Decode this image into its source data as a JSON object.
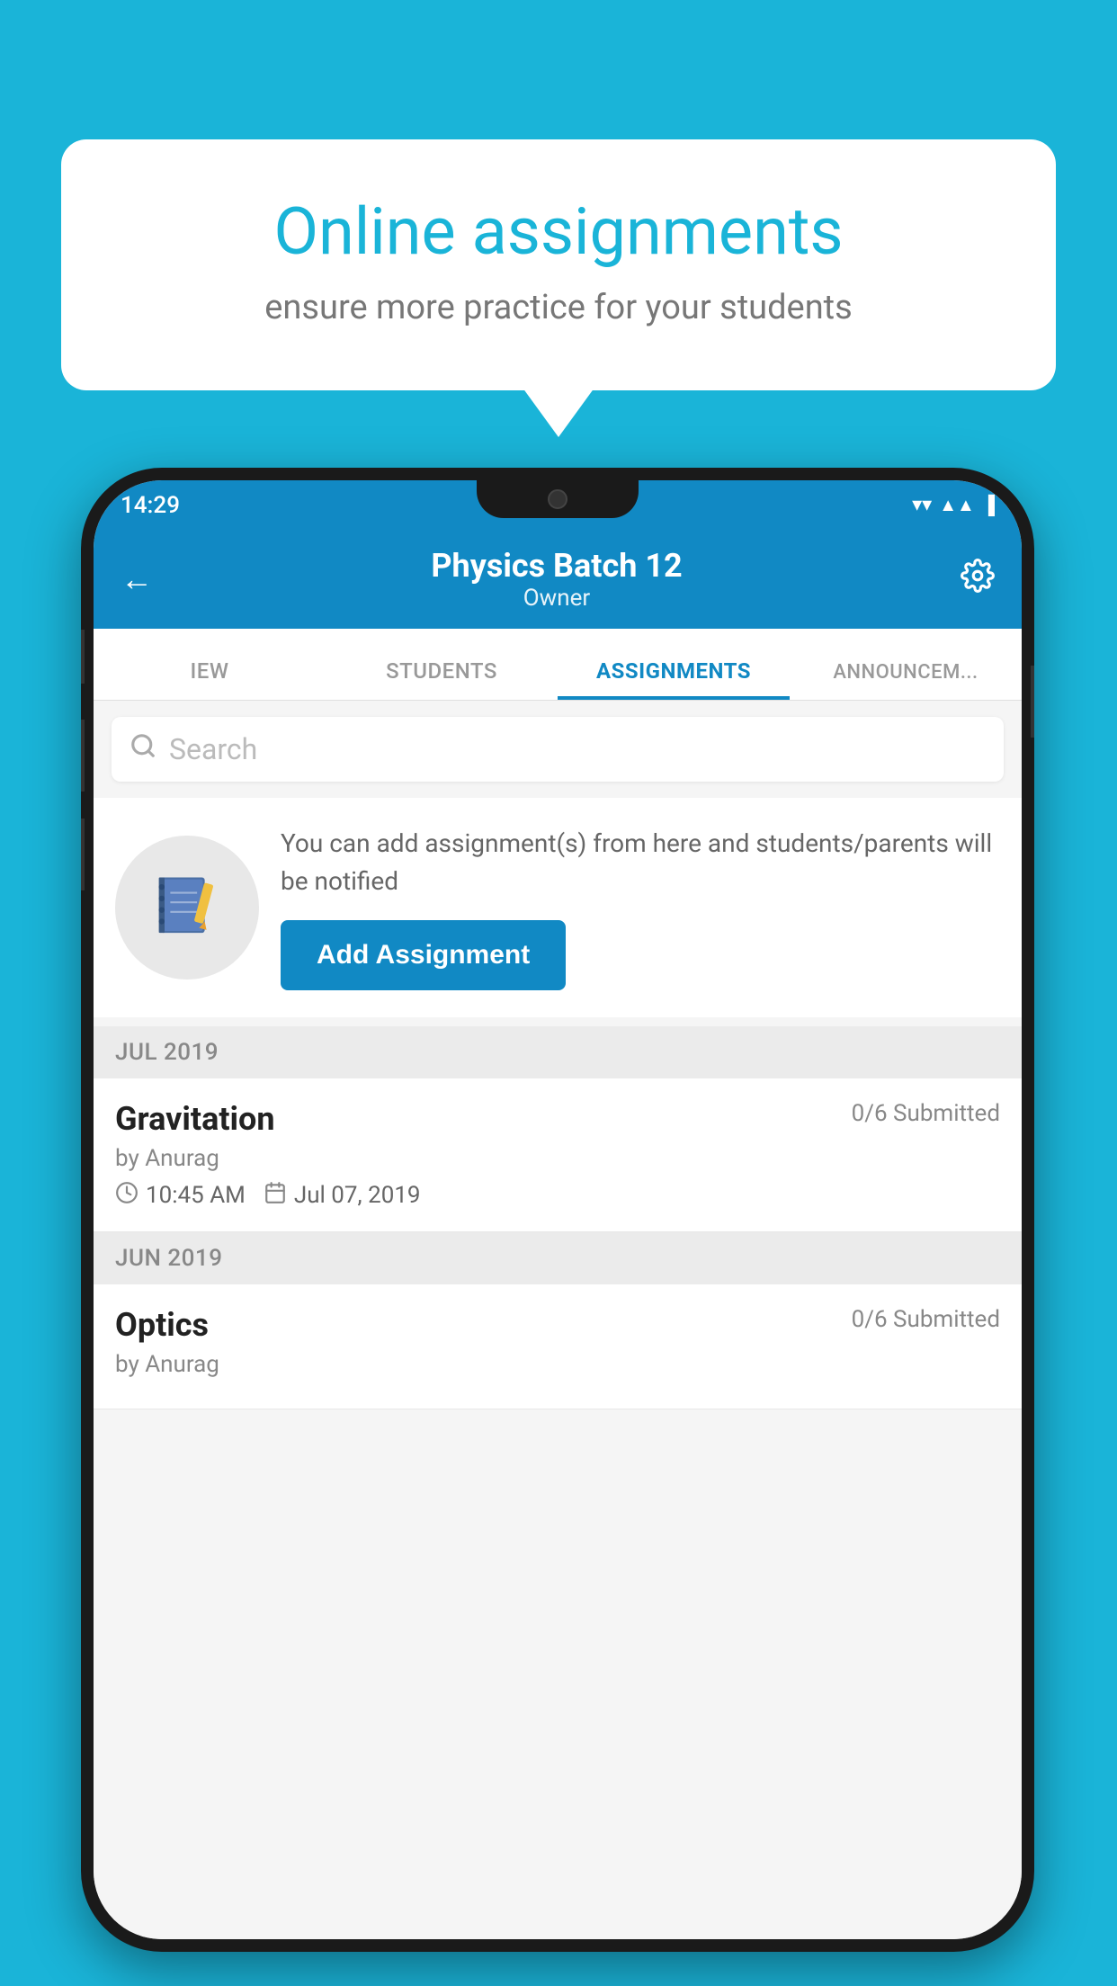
{
  "background_color": "#1ab4d8",
  "speech_bubble": {
    "title": "Online assignments",
    "subtitle": "ensure more practice for your students"
  },
  "phone": {
    "status_bar": {
      "time": "14:29",
      "icons": [
        "wifi",
        "signal",
        "battery"
      ]
    },
    "header": {
      "title": "Physics Batch 12",
      "subtitle": "Owner",
      "back_label": "←",
      "settings_label": "⚙"
    },
    "tabs": [
      {
        "label": "IEW",
        "active": false
      },
      {
        "label": "STUDENTS",
        "active": false
      },
      {
        "label": "ASSIGNMENTS",
        "active": true
      },
      {
        "label": "ANNOUNCEM...",
        "active": false
      }
    ],
    "search": {
      "placeholder": "Search"
    },
    "promo": {
      "description": "You can add assignment(s) from here and students/parents will be notified",
      "button_label": "Add Assignment"
    },
    "assignments": [
      {
        "month_label": "JUL 2019",
        "items": [
          {
            "name": "Gravitation",
            "submitted": "0/6 Submitted",
            "author": "by Anurag",
            "time": "10:45 AM",
            "date": "Jul 07, 2019"
          }
        ]
      },
      {
        "month_label": "JUN 2019",
        "items": [
          {
            "name": "Optics",
            "submitted": "0/6 Submitted",
            "author": "by Anurag",
            "time": "",
            "date": ""
          }
        ]
      }
    ]
  }
}
